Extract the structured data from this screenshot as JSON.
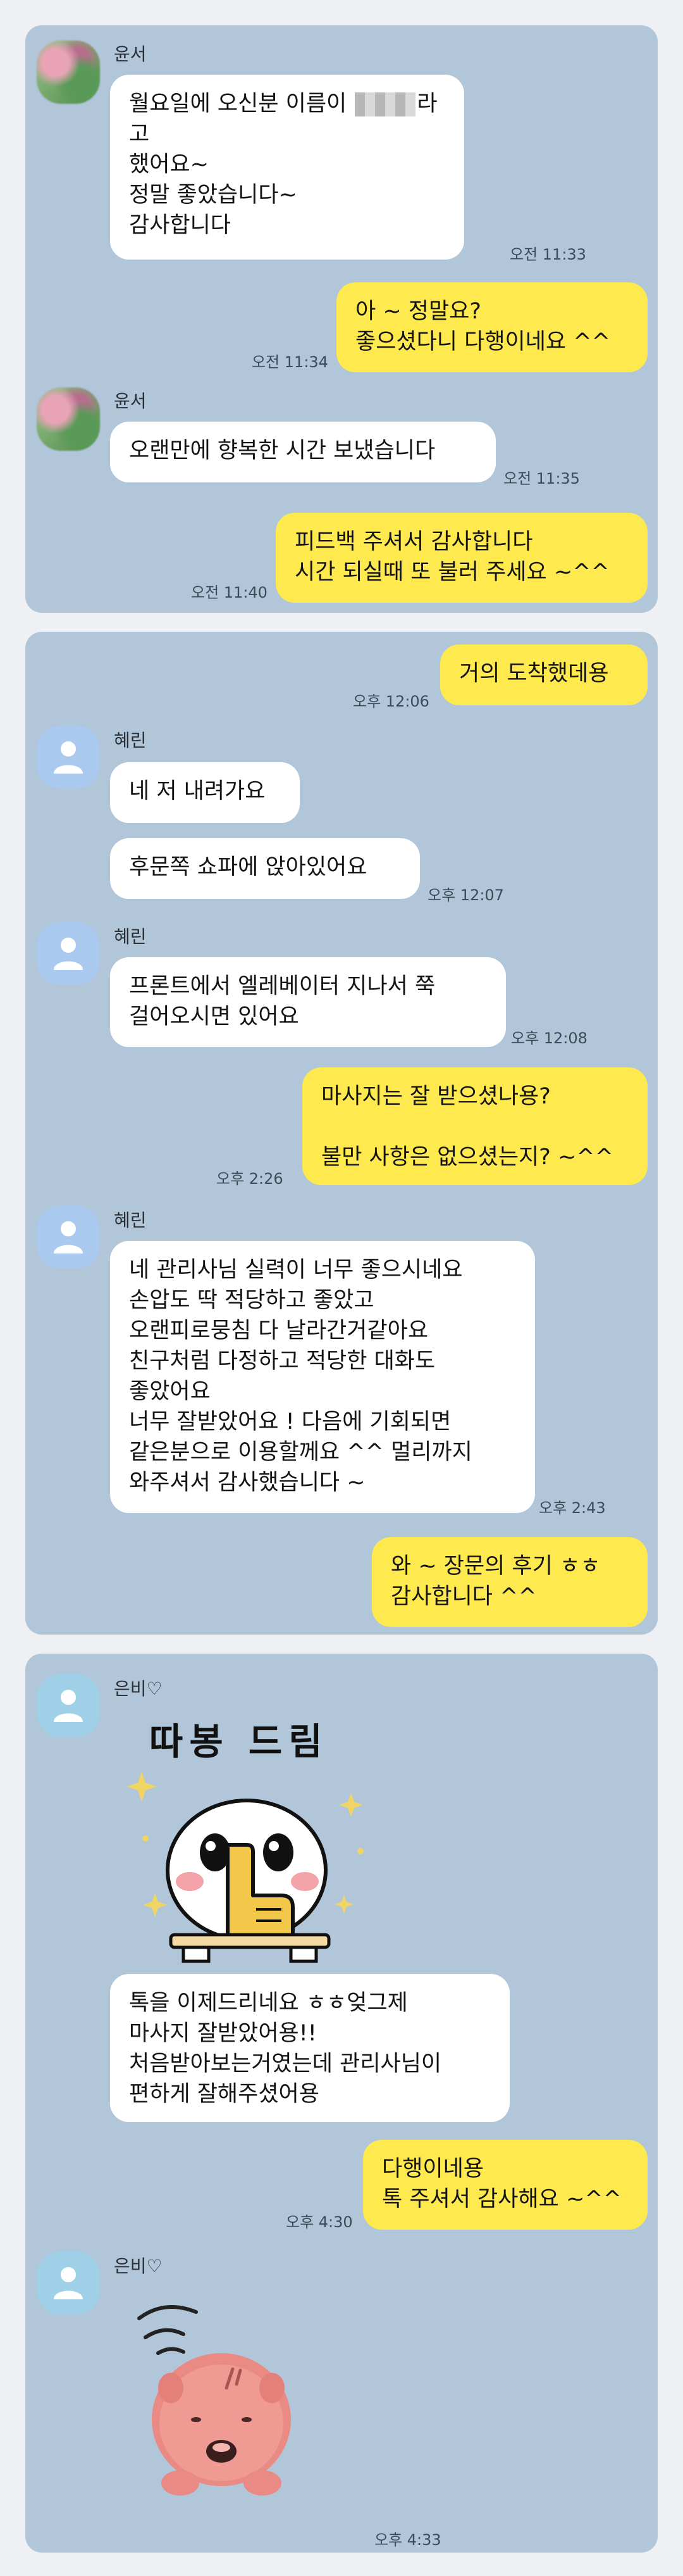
{
  "panels": [
    {
      "messages": [
        {
          "sender": "윤서",
          "text_before": "월요일에 오신분 이름이 ",
          "text_after": "라고\n했어요~\n정말 좋았습니다~\n감사합니다",
          "time": "오전 11:33"
        },
        {
          "text": "아 ~ 정말요?\n좋으셨다니 다행이네요 ^^",
          "time": "오전 11:34"
        },
        {
          "sender": "윤서",
          "text": "오랜만에 향복한 시간 보냈습니다",
          "time": "오전 11:35"
        },
        {
          "text": "피드백 주셔서 감사합니다\n시간 되실때 또 불러 주세요 ~^^",
          "time": "오전 11:40"
        }
      ]
    },
    {
      "messages": [
        {
          "text": "거의 도착했데용",
          "time": "오후 12:06"
        },
        {
          "sender": "혜린",
          "text": "네 저 내려가요"
        },
        {
          "text": "후문쪽 쇼파에 앉아있어요",
          "time": "오후 12:07"
        },
        {
          "sender": "혜린",
          "text": "프론트에서 엘레베이터 지나서 쭉\n걸어오시면 있어요",
          "time": "오후 12:08"
        },
        {
          "text": "마사지는 잘 받으셨나용?\n\n불만 사항은 없으셨는지? ~^^",
          "time": "오후 2:26"
        },
        {
          "sender": "혜린",
          "text": "네 관리사님 실력이 너무 좋으시네요\n손압도 딱 적당하고 좋았고\n오랜피로뭉침 다 날라간거같아요\n친구처럼 다정하고 적당한 대화도\n좋았어요\n너무 잘받았어요 ! 다음에 기회되면\n같은분으로 이용할께요 ^^ 멀리까지\n와주셔서 감사했습니다 ~",
          "time": "오후 2:43"
        },
        {
          "text": "와 ~ 장문의 후기 ㅎㅎ\n감사합니다 ^^"
        }
      ]
    },
    {
      "messages": [
        {
          "sender": "은비♡",
          "sticker_text": "따봉 드림"
        },
        {
          "text": "톡을 이제드리네요 ㅎㅎ엊그제\n마사지 잘받았어용!!\n처음받아보는거였는데 관리사님이\n편하게 잘해주셨어용"
        },
        {
          "text": "다행이네용\n톡 주셔서 감사해요 ~^^",
          "time": "오후 4:30"
        },
        {
          "sender": "은비♡",
          "time": "오후 4:33"
        }
      ]
    }
  ],
  "colors": {
    "chat_bg": "#b2c6da",
    "bubble_in": "#ffffff",
    "bubble_out": "#fee94e"
  },
  "icons": {
    "blurred_avatar": "pixelated-profile-photo",
    "default_avatar": "person-silhouette-icon",
    "sticker_1": "thumbs-up-character-sticker",
    "sticker_2": "pink-hamster-sticker"
  }
}
